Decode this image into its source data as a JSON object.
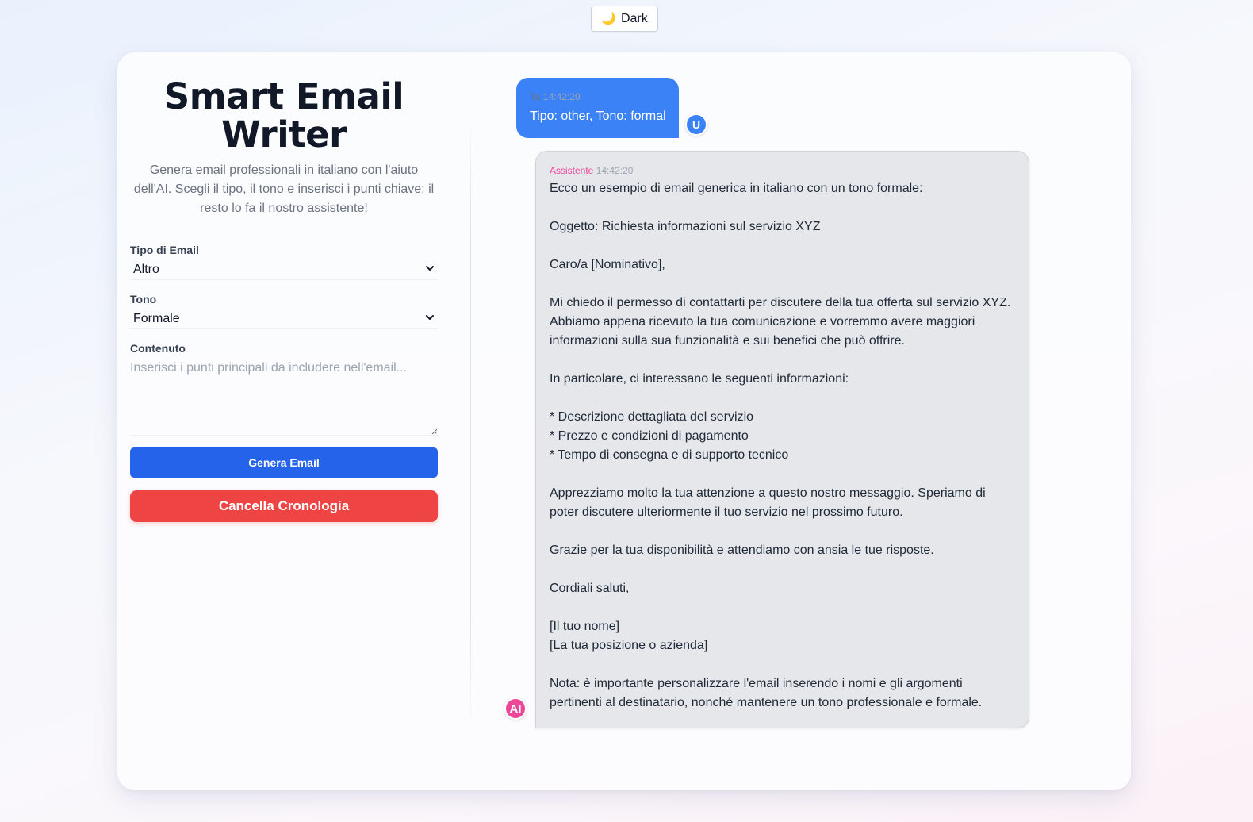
{
  "theme_toggle": {
    "icon": "moon-icon",
    "label": "Dark"
  },
  "header": {
    "title": "Smart Email Writer",
    "subtitle": "Genera email professionali in italiano con l'aiuto dell'AI. Scegli il tipo, il tono e inserisci i punti chiave: il resto lo fa il nostro assistente!"
  },
  "form": {
    "email_type": {
      "label": "Tipo di Email",
      "value": "Altro"
    },
    "tone": {
      "label": "Tono",
      "value": "Formale"
    },
    "content": {
      "label": "Contenuto",
      "placeholder": "Inserisci i punti principali da includere nell'email..."
    },
    "generate_label": "Genera Email",
    "clear_label": "Cancella Cronologia"
  },
  "chat": {
    "user_message": {
      "sender": "Tu",
      "time": "14:42:20",
      "text": "Tipo: other, Tono: formal",
      "avatar": "U"
    },
    "ai_message": {
      "sender": "Assistente",
      "time": "14:42:20",
      "avatar": "AI",
      "text": "Ecco un esempio di email generica in italiano con un tono formale:\n\nOggetto: Richiesta informazioni sul servizio XYZ\n\nCaro/a [Nominativo],\n\nMi chiedo il permesso di contattarti per discutere della tua offerta sul servizio XYZ. Abbiamo appena ricevuto la tua comunicazione e vorremmo avere maggiori informazioni sulla sua funzionalità e sui benefici che può offrire.\n\nIn particolare, ci interessano le seguenti informazioni:\n\n* Descrizione dettagliata del servizio\n* Prezzo e condizioni di pagamento\n* Tempo di consegna e di supporto tecnico\n\nApprezziamo molto la tua attenzione a questo nostro messaggio. Speriamo di poter discutere ulteriormente il tuo servizio nel prossimo futuro.\n\nGrazie per la tua disponibilità e attendiamo con ansia le tue risposte.\n\nCordiali saluti,\n\n[Il tuo nome]\n[La tua posizione o azienda]\n\nNota: è importante personalizzare l'email inserendo i nomi e gli argomenti pertinenti al destinatario, nonché mantenere un tono professionale e formale."
    }
  },
  "colors": {
    "primary": "#2563eb",
    "user_bubble": "#3b82f6",
    "danger": "#ef4444",
    "ai_accent": "#ec4899",
    "ai_bubble": "#e5e7eb"
  }
}
